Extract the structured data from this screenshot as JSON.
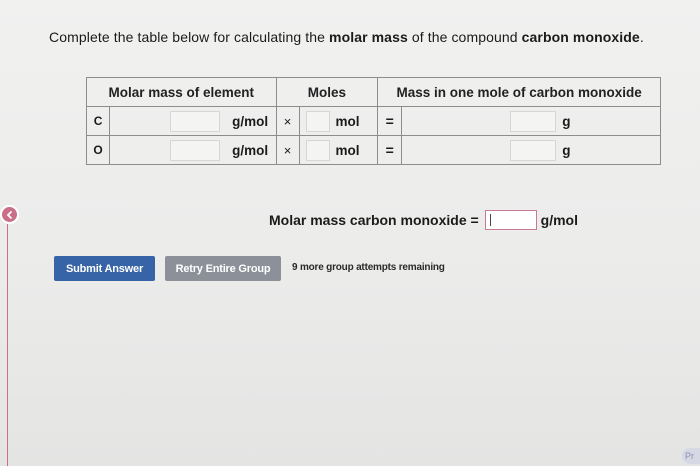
{
  "instruction": {
    "prefix": "Complete the table below for calculating the",
    "bold1": "molar mass",
    "middle": "of the compound",
    "bold2": "carbon monoxide",
    "suffix": "."
  },
  "table": {
    "headers": {
      "molar_mass": "Molar mass of element",
      "moles": "Moles",
      "mass": "Mass in one mole of carbon monoxide"
    },
    "rows": [
      {
        "element": "C",
        "mass_unit": "g/mol",
        "times": "×",
        "mol_unit": "mol",
        "equals": "=",
        "result_unit": "g"
      },
      {
        "element": "O",
        "mass_unit": "g/mol",
        "times": "×",
        "mol_unit": "mol",
        "equals": "=",
        "result_unit": "g"
      }
    ]
  },
  "answer": {
    "label": "Molar mass carbon monoxide =",
    "unit": "g/mol",
    "value": ""
  },
  "buttons": {
    "submit": "Submit Answer",
    "retry": "Retry Entire Group"
  },
  "attempts_text": "9 more group attempts remaining",
  "corner_text": "Pr",
  "colors": {
    "submit": "#3764a6",
    "retry": "#8c9098",
    "active_field": "#c77b95",
    "back_button": "#c96f87"
  }
}
